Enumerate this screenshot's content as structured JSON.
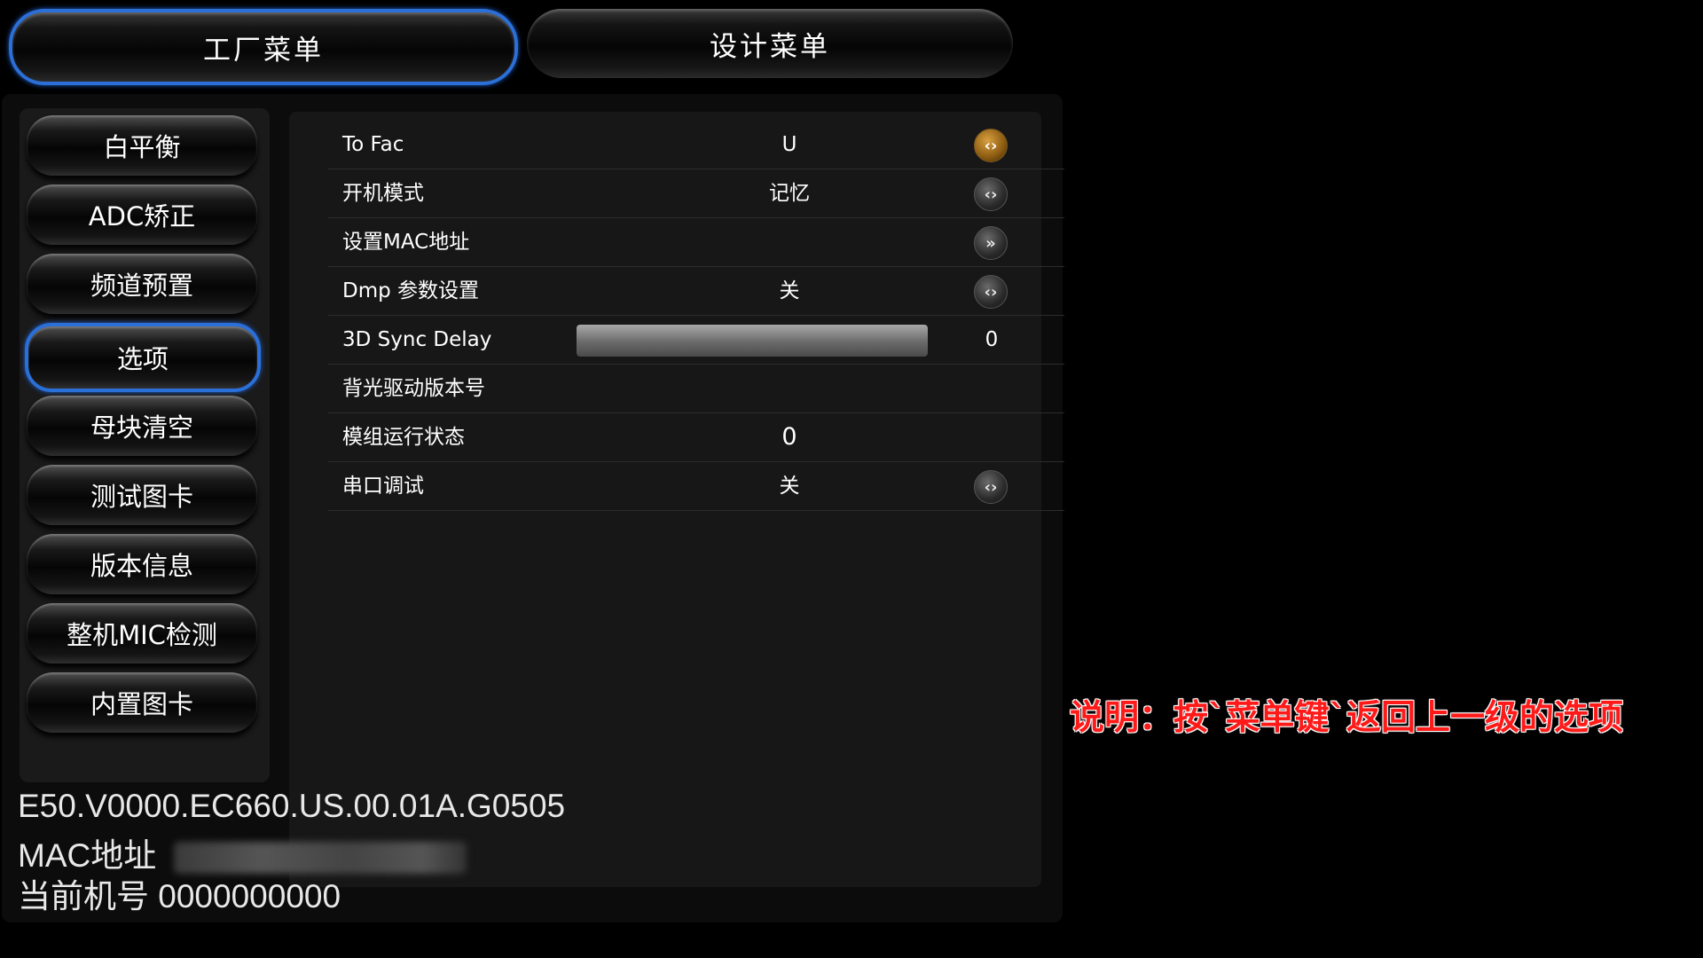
{
  "tabs": {
    "factory_label": "工厂菜单",
    "design_label": "设计菜单"
  },
  "menu": {
    "items": [
      "白平衡",
      "ADC矫正",
      "频道预置",
      "选项",
      "母块清空",
      "测试图卡",
      "版本信息",
      "整机MIC检测",
      "内置图卡"
    ],
    "selected": "选项"
  },
  "settings": {
    "rows": [
      {
        "label": "To Fac",
        "value": "U",
        "control": "arrow-left-right",
        "active": true
      },
      {
        "label": "开机模式",
        "value": "记忆",
        "control": "arrow-left-right"
      },
      {
        "label": "设置MAC地址",
        "value": "",
        "control": "arrow-forward"
      },
      {
        "label": "Dmp 参数设置",
        "value": "关",
        "control": "arrow-left-right"
      },
      {
        "label": "3D Sync Delay",
        "value": "0",
        "control": "slider",
        "slider_fraction": 1.0
      },
      {
        "label": "背光驱动版本号",
        "value": "",
        "control": "none"
      },
      {
        "label": "模组运行状态",
        "value": "0",
        "control": "none"
      },
      {
        "label": "串口调试",
        "value": "关",
        "control": "arrow-left-right"
      }
    ]
  },
  "info": {
    "version": "E50.V0000.EC660.US.00.01A.G0505",
    "mac_label": "MAC地址",
    "model_line": "当前机号 0000000000"
  },
  "note": "说明：按`菜单键`返回上一级的选项",
  "colors": {
    "selection_border": "#2b6fd9",
    "note_text": "#ff1a1a",
    "active_arrow": "#d9a040"
  }
}
